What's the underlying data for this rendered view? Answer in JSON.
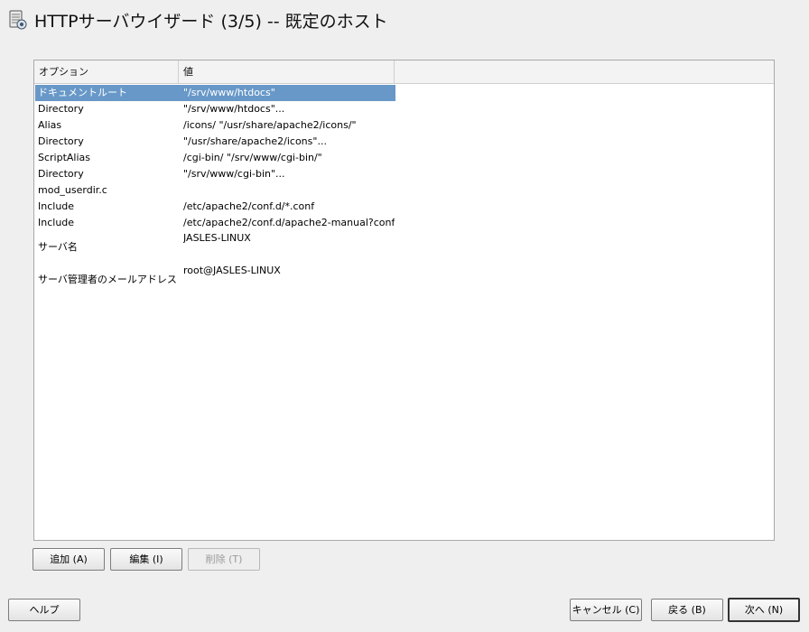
{
  "window": {
    "title": "HTTPサーバウイザード (3/5) -- 既定のホスト",
    "icon": "server-config-icon"
  },
  "table": {
    "columns": [
      "オプション",
      "値"
    ],
    "rows": [
      {
        "option": "ドキュメントルート",
        "value": "\"/srv/www/htdocs\"",
        "selected": true
      },
      {
        "option": "Directory",
        "value": "\"/srv/www/htdocs\"..."
      },
      {
        "option": "Alias",
        "value": "/icons/ \"/usr/share/apache2/icons/\""
      },
      {
        "option": "Directory",
        "value": "\"/usr/share/apache2/icons\"..."
      },
      {
        "option": "ScriptAlias",
        "value": "/cgi-bin/ \"/srv/www/cgi-bin/\""
      },
      {
        "option": "Directory",
        "value": "\"/srv/www/cgi-bin\"..."
      },
      {
        "option": "mod_userdir.c",
        "value": ""
      },
      {
        "option": "Include",
        "value": "/etc/apache2/conf.d/*.conf"
      },
      {
        "option": "Include",
        "value": "/etc/apache2/conf.d/apache2-manual?conf"
      },
      {
        "option": "サーバ名",
        "value": "JASLES-LINUX"
      },
      {
        "option": "サーバ管理者のメールアドレス",
        "value": "root@JASLES-LINUX"
      }
    ]
  },
  "actions": {
    "add": "追加 (A)",
    "edit": "編集 (I)",
    "delete": "削除 (T)"
  },
  "footer": {
    "help": "ヘルプ",
    "cancel": "キャンセル (C)",
    "back": "戻る (B)",
    "next": "次へ (N)"
  },
  "colors": {
    "selection": "#6898c8",
    "background": "#efefef"
  }
}
